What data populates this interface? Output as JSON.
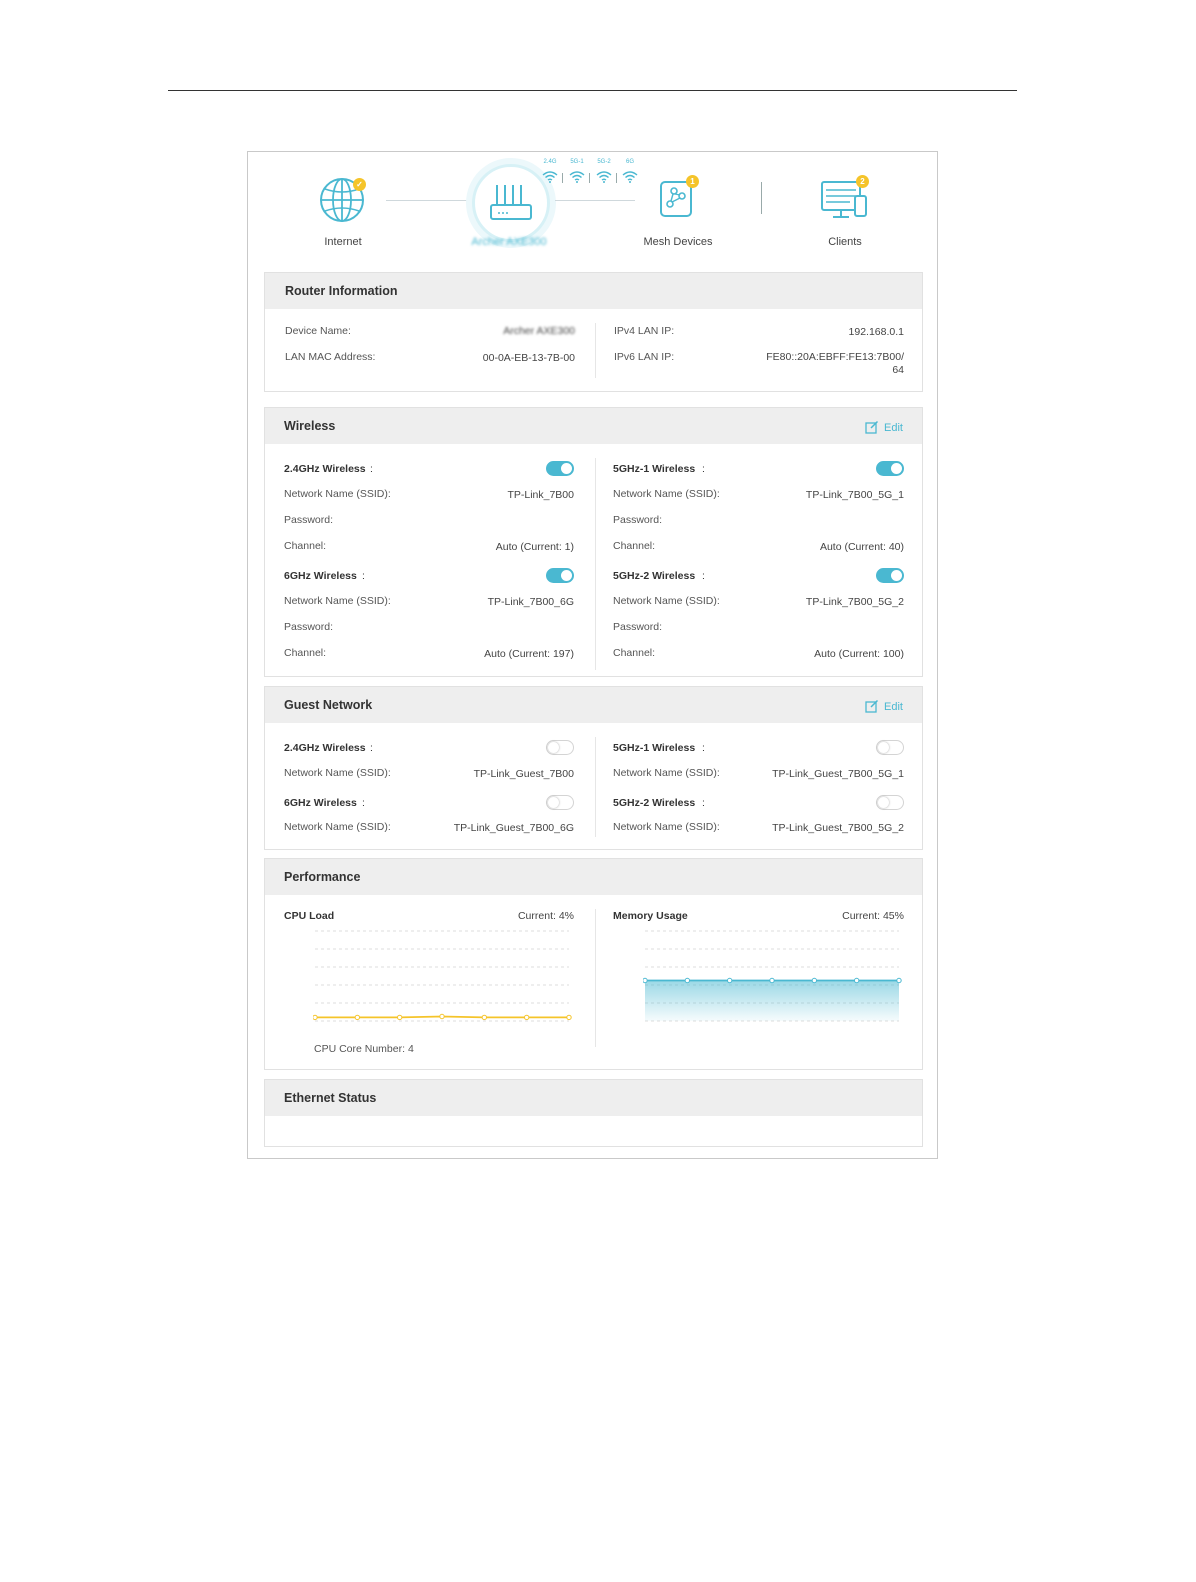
{
  "topology": {
    "internet_label": "Internet",
    "router_label": "Archer AXE300",
    "mesh_label": "Mesh Devices",
    "clients_label": "Clients",
    "bands": [
      "2.4G",
      "5G-1",
      "5G-2",
      "6G"
    ],
    "mesh_badge": "1",
    "clients_badge": "2"
  },
  "router_info": {
    "title": "Router Information",
    "device_name_label": "Device Name:",
    "device_name_value": "Archer AXE300",
    "lan_mac_label": "LAN MAC Address:",
    "lan_mac_value": "00-0A-EB-13-7B-00",
    "ipv4_label": "IPv4 LAN IP:",
    "ipv4_value": "192.168.0.1",
    "ipv6_label": "IPv6 LAN IP:",
    "ipv6_value_line1": "FE80::20A:EBFF:FE13:7B00/",
    "ipv6_value_line2": "64"
  },
  "wireless": {
    "title": "Wireless",
    "edit_label": "Edit",
    "ssid_label": "Network Name (SSID):",
    "password_label": "Password:",
    "channel_label": "Channel:",
    "bands": [
      {
        "name": "2.4GHz Wireless",
        "ssid": "TP-Link_7B00",
        "channel": "Auto (Current: 1)",
        "enabled": true
      },
      {
        "name": "5GHz-1 Wireless",
        "ssid": "TP-Link_7B00_5G_1",
        "channel": "Auto (Current: 40)",
        "enabled": true
      },
      {
        "name": "6GHz Wireless",
        "ssid": "TP-Link_7B00_6G",
        "channel": "Auto (Current: 197)",
        "enabled": true
      },
      {
        "name": "5GHz-2 Wireless",
        "ssid": "TP-Link_7B00_5G_2",
        "channel": "Auto (Current: 100)",
        "enabled": true
      }
    ]
  },
  "guest": {
    "title": "Guest Network",
    "edit_label": "Edit",
    "ssid_label": "Network Name (SSID):",
    "bands": [
      {
        "name": "2.4GHz Wireless",
        "ssid": "TP-Link_Guest_7B00",
        "enabled": false
      },
      {
        "name": "5GHz-1 Wireless",
        "ssid": "TP-Link_Guest_7B00_5G_1",
        "enabled": false
      },
      {
        "name": "6GHz Wireless",
        "ssid": "TP-Link_Guest_7B00_6G",
        "enabled": false
      },
      {
        "name": "5GHz-2 Wireless",
        "ssid": "TP-Link_Guest_7B00_5G_2",
        "enabled": false
      }
    ]
  },
  "performance": {
    "title": "Performance",
    "cpu_label": "CPU Load",
    "cpu_current": "Current: 4%",
    "cpu_core": "CPU Core Number: 4",
    "mem_label": "Memory Usage",
    "mem_current": "Current: 45%",
    "cpu_color": "#f5c42a",
    "mem_color": "#4ab8d1"
  },
  "ethernet": {
    "title": "Ethernet Status"
  },
  "chart_data": [
    {
      "type": "line",
      "name": "cpu",
      "values": [
        4,
        4,
        4,
        5,
        4,
        4,
        4
      ],
      "ylim": [
        0,
        100
      ]
    },
    {
      "type": "area",
      "name": "memory",
      "values": [
        45,
        45,
        45,
        45,
        45,
        45,
        45
      ],
      "ylim": [
        0,
        100
      ]
    }
  ]
}
